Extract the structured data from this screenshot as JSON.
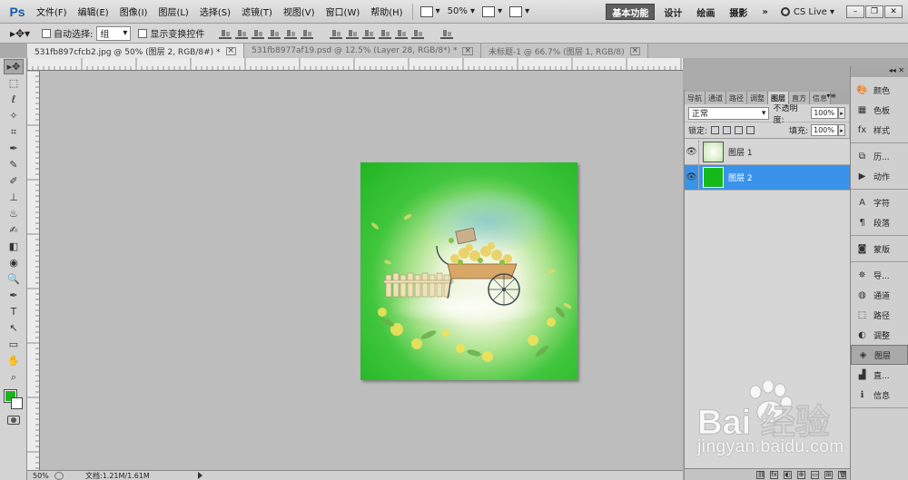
{
  "app": {
    "logo": "Ps"
  },
  "menu": {
    "items": [
      "文件(F)",
      "编辑(E)",
      "图像(I)",
      "图层(L)",
      "选择(S)",
      "滤镜(T)",
      "视图(V)",
      "窗口(W)",
      "帮助(H)"
    ],
    "zoom": "50%"
  },
  "workspace": {
    "buttons": [
      "基本功能",
      "设计",
      "绘画",
      "摄影"
    ],
    "more": "»",
    "cslive": "CS Live"
  },
  "options": {
    "auto_select": "自动选择:",
    "auto_select_value": "组",
    "show_transform": "显示变换控件"
  },
  "tabs": [
    {
      "label": "531fb897cfcb2.jpg @ 50% (图层 2, RGB/8#) *",
      "active": true
    },
    {
      "label": "531fb8977af19.psd @ 12.5% (Layer 28, RGB/8*) *",
      "active": false
    },
    {
      "label": "未标题-1 @ 66.7% (图层 1, RGB/8)",
      "active": false
    }
  ],
  "tools": [
    "▸✥",
    "⬚",
    "ℓ",
    "✧",
    "⌗",
    "✒",
    "✎",
    "✐",
    "⊥",
    "♨",
    "✍",
    "◧",
    "◉",
    "🔍",
    "✒",
    "T",
    "↖",
    "▭",
    "✋",
    "⌕"
  ],
  "colors": {
    "foreground": "#1bb51d",
    "background": "#ffffff",
    "accent": "#3a93e9"
  },
  "status": {
    "zoom": "50%",
    "doc": "文档:1.21M/1.61M"
  },
  "layers_panel": {
    "tabs": [
      "导航",
      "通道",
      "路径",
      "调整",
      "图层",
      "直方",
      "信息"
    ],
    "active_tab": "图层",
    "blend_mode": "正常",
    "opacity_label": "不透明度:",
    "opacity": "100%",
    "lock_label": "锁定:",
    "fill_label": "填充:",
    "fill": "100%",
    "layers": [
      {
        "name": "图层 1",
        "selected": false,
        "thumb": "img"
      },
      {
        "name": "图层 2",
        "selected": true,
        "thumb": "green"
      }
    ],
    "bottom_icons": [
      "fx",
      "◐",
      "⊕",
      "▭",
      "⊞",
      "🗑"
    ]
  },
  "dock": {
    "groups": [
      [
        {
          "label": "颜色",
          "icon": "palette-icon"
        },
        {
          "label": "色板",
          "icon": "swatches-icon"
        },
        {
          "label": "样式",
          "icon": "styles-icon"
        }
      ],
      [
        {
          "label": "历...",
          "icon": "history-icon"
        },
        {
          "label": "动作",
          "icon": "actions-icon"
        }
      ],
      [
        {
          "label": "字符",
          "icon": "character-icon"
        },
        {
          "label": "段落",
          "icon": "paragraph-icon"
        }
      ],
      [
        {
          "label": "蒙版",
          "icon": "masks-icon"
        }
      ],
      [
        {
          "label": "导...",
          "icon": "navigator-icon"
        },
        {
          "label": "通道",
          "icon": "channels-icon"
        },
        {
          "label": "路径",
          "icon": "paths-icon"
        },
        {
          "label": "调整",
          "icon": "adjustments-icon"
        },
        {
          "label": "图层",
          "icon": "layers-icon",
          "selected": true
        },
        {
          "label": "直...",
          "icon": "histogram-icon"
        },
        {
          "label": "信息",
          "icon": "info-icon"
        }
      ]
    ]
  },
  "watermark": {
    "brand": "Bai 经验",
    "url": "jingyan.baidu.com"
  }
}
